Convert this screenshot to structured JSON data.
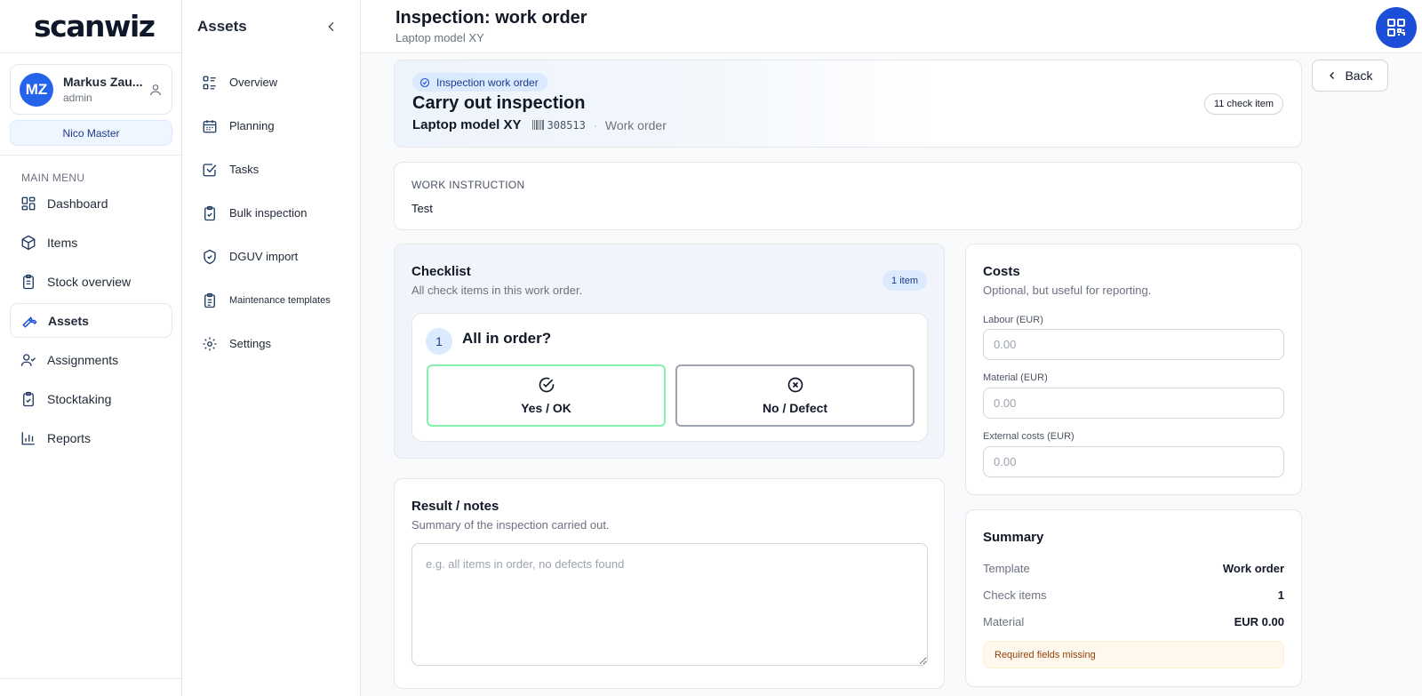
{
  "app": {
    "logo_text": "scanwiz"
  },
  "user": {
    "initials": "MZ",
    "name": "Markus Zau...",
    "role": "admin",
    "org_button": "Nico Master"
  },
  "sidebar": {
    "menu_label": "MAIN MENU",
    "items": [
      {
        "label": "Dashboard",
        "icon": "dashboard-icon",
        "active": false
      },
      {
        "label": "Items",
        "icon": "cube-icon",
        "active": false
      },
      {
        "label": "Stock overview",
        "icon": "clipboard-icon",
        "active": false
      },
      {
        "label": "Assets",
        "icon": "wrench-icon",
        "active": true
      },
      {
        "label": "Assignments",
        "icon": "user-check-icon",
        "active": false
      },
      {
        "label": "Stocktaking",
        "icon": "clipboard-check-icon",
        "active": false
      },
      {
        "label": "Reports",
        "icon": "bar-chart-icon",
        "active": false
      }
    ]
  },
  "subnav": {
    "title": "Assets",
    "items": [
      {
        "label": "Overview",
        "icon": "list-icon"
      },
      {
        "label": "Planning",
        "icon": "calendar-icon"
      },
      {
        "label": "Tasks",
        "icon": "checkbox-icon"
      },
      {
        "label": "Bulk inspection",
        "icon": "clipboard-check-icon"
      },
      {
        "label": "DGUV import",
        "icon": "shield-check-icon"
      },
      {
        "label": "Maintenance templates",
        "icon": "clipboard-list-icon"
      },
      {
        "label": "Settings",
        "icon": "gear-icon"
      }
    ]
  },
  "header": {
    "title": "Inspection: work order",
    "subtitle": "Laptop model XY"
  },
  "hero": {
    "badge": "Inspection work order",
    "title": "Carry out inspection",
    "model": "Laptop model XY",
    "barcode": "308513",
    "separator": "·",
    "type": "Work order",
    "pill": "11 check item"
  },
  "instruction": {
    "label": "WORK INSTRUCTION",
    "text": "Test"
  },
  "checklist": {
    "title": "Checklist",
    "subtitle": "All check items in this work order.",
    "count": "1 item",
    "question": {
      "number": "1",
      "text": "All in order?",
      "yes_label": "Yes / OK",
      "no_label": "No / Defect"
    }
  },
  "notes": {
    "title": "Result / notes",
    "subtitle": "Summary of the inspection carried out.",
    "placeholder": "e.g. all items in order, no defects found"
  },
  "costs": {
    "title": "Costs",
    "subtitle": "Optional, but useful for reporting.",
    "labour_label": "Labour (EUR)",
    "labour_placeholder": "0.00",
    "material_label": "Material (EUR)",
    "material_placeholder": "0.00",
    "external_label": "External costs (EUR)",
    "external_placeholder": "0.00"
  },
  "summary": {
    "title": "Summary",
    "rows": [
      {
        "key": "Template",
        "value": "Work order"
      },
      {
        "key": "Check items",
        "value": "1"
      },
      {
        "key": "Material",
        "value": "EUR 0.00"
      }
    ],
    "warning": "Required fields missing"
  },
  "actions": {
    "back_label": "Back"
  },
  "colors": {
    "accent": "#1d4ed8",
    "ok": "#86efac",
    "warning_bg": "#fef9ec"
  }
}
